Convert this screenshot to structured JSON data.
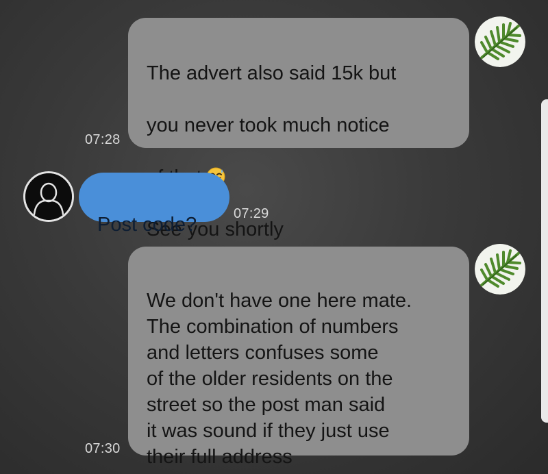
{
  "messages": [
    {
      "id": "msg1",
      "direction": "outgoing",
      "lines": [
        "The advert also said 15k but",
        "you never took much notice",
        "of that",
        "See you shortly"
      ],
      "emoji": "grinning-sweat-emoji",
      "time": "07:28"
    },
    {
      "id": "msg2",
      "direction": "incoming",
      "text": "Post code?",
      "time": "07:29"
    },
    {
      "id": "msg3",
      "direction": "outgoing",
      "text": "We don't have one here mate.\nThe combination of numbers\nand letters confuses some\nof the older residents on the\nstreet so the post man said\nit was sound if they just use\ntheir full address",
      "time": "07:30"
    }
  ],
  "avatars": {
    "outgoing": "fern-leaf-avatar",
    "incoming": "default-user-silhouette-avatar"
  },
  "colors": {
    "background": "#3a3a3a",
    "outgoing_bubble": "#8e8e8e",
    "incoming_bubble": "#4a8fd9",
    "timestamp": "#d8d8d8"
  }
}
